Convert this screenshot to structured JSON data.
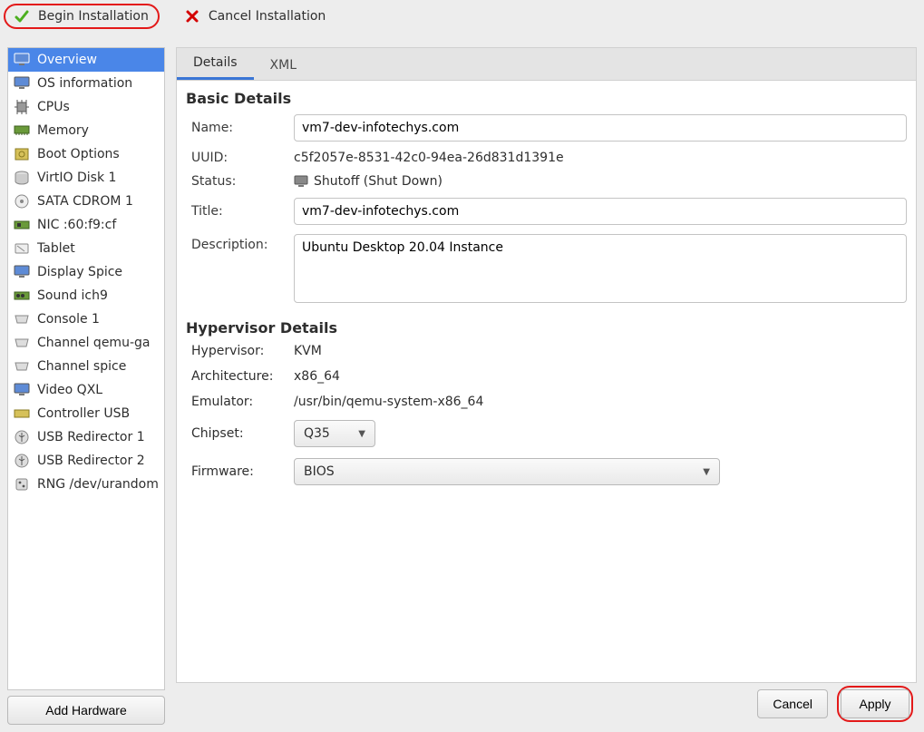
{
  "toolbar": {
    "begin_label": "Begin Installation",
    "cancel_label": "Cancel Installation"
  },
  "sidebar": {
    "items": [
      {
        "label": "Overview",
        "icon": "monitor",
        "selected": true
      },
      {
        "label": "OS information",
        "icon": "monitor",
        "selected": false
      },
      {
        "label": "CPUs",
        "icon": "cpu",
        "selected": false
      },
      {
        "label": "Memory",
        "icon": "ram",
        "selected": false
      },
      {
        "label": "Boot Options",
        "icon": "boot",
        "selected": false
      },
      {
        "label": "VirtIO Disk 1",
        "icon": "disk",
        "selected": false
      },
      {
        "label": "SATA CDROM 1",
        "icon": "cdrom",
        "selected": false
      },
      {
        "label": "NIC :60:f9:cf",
        "icon": "nic",
        "selected": false
      },
      {
        "label": "Tablet",
        "icon": "tablet",
        "selected": false
      },
      {
        "label": "Display Spice",
        "icon": "monitor",
        "selected": false
      },
      {
        "label": "Sound ich9",
        "icon": "sound",
        "selected": false
      },
      {
        "label": "Console 1",
        "icon": "serial",
        "selected": false
      },
      {
        "label": "Channel qemu-ga",
        "icon": "serial",
        "selected": false
      },
      {
        "label": "Channel spice",
        "icon": "serial",
        "selected": false
      },
      {
        "label": "Video QXL",
        "icon": "monitor",
        "selected": false
      },
      {
        "label": "Controller USB",
        "icon": "usbctl",
        "selected": false
      },
      {
        "label": "USB Redirector 1",
        "icon": "usb",
        "selected": false
      },
      {
        "label": "USB Redirector 2",
        "icon": "usb",
        "selected": false
      },
      {
        "label": "RNG /dev/urandom",
        "icon": "rng",
        "selected": false
      }
    ],
    "add_hw_label": "Add Hardware"
  },
  "tabs": {
    "details": "Details",
    "xml": "XML"
  },
  "basic": {
    "heading": "Basic Details",
    "name_label": "Name:",
    "name_value": "vm7-dev-infotechys.com",
    "uuid_label": "UUID:",
    "uuid_value": "c5f2057e-8531-42c0-94ea-26d831d1391e",
    "status_label": "Status:",
    "status_value": "Shutoff (Shut Down)",
    "title_label": "Title:",
    "title_value": "vm7-dev-infotechys.com",
    "desc_label": "Description:",
    "desc_value": "Ubuntu Desktop 20.04 Instance"
  },
  "hv": {
    "heading": "Hypervisor Details",
    "hypervisor_label": "Hypervisor:",
    "hypervisor_value": "KVM",
    "arch_label": "Architecture:",
    "arch_value": "x86_64",
    "emulator_label": "Emulator:",
    "emulator_value": "/usr/bin/qemu-system-x86_64",
    "chipset_label": "Chipset:",
    "chipset_value": "Q35",
    "firmware_label": "Firmware:",
    "firmware_value": "BIOS"
  },
  "footer": {
    "cancel": "Cancel",
    "apply": "Apply"
  }
}
